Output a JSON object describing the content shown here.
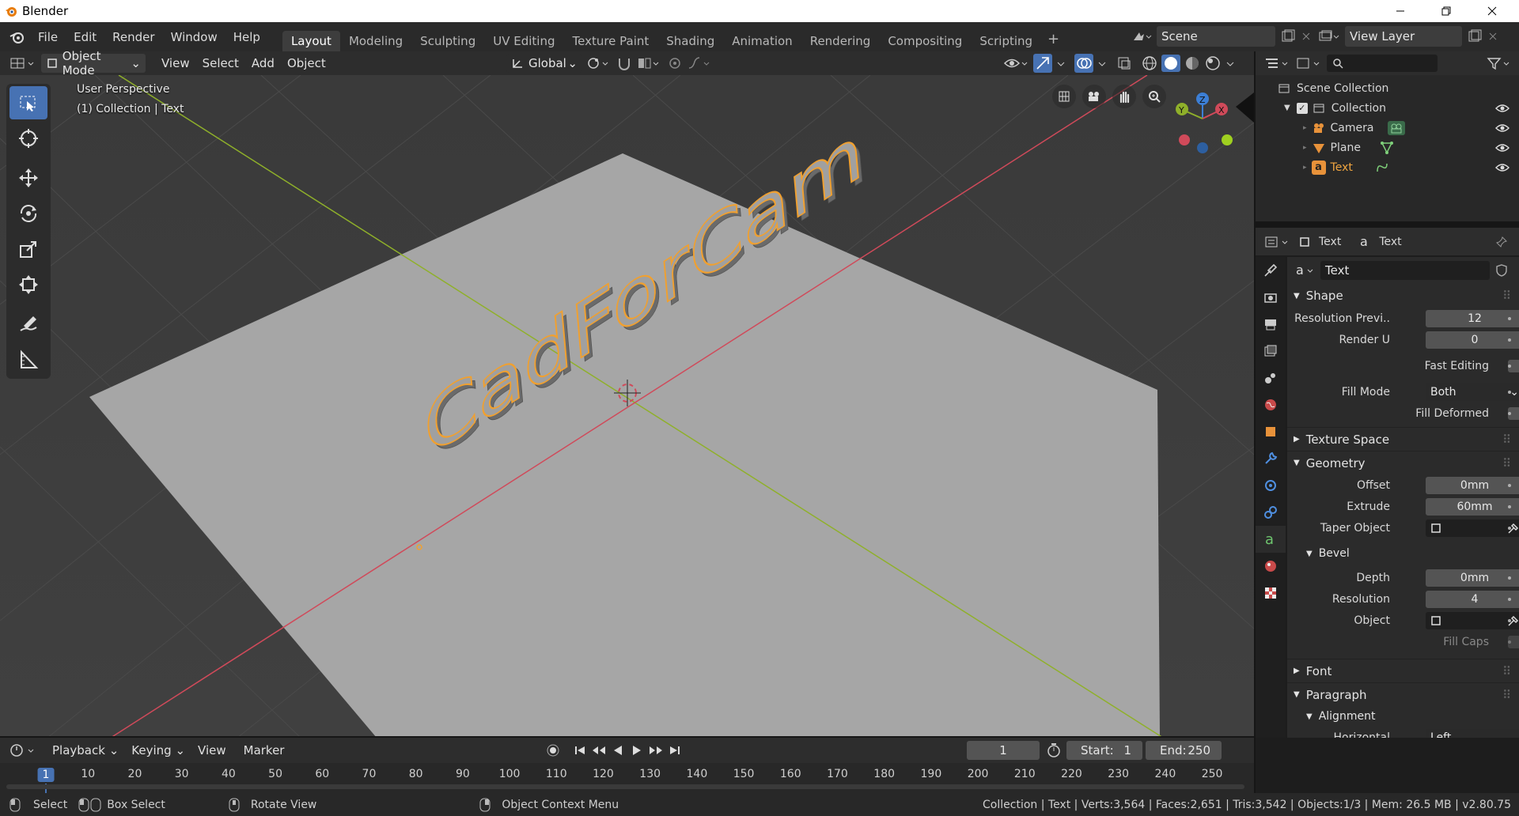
{
  "app": {
    "title": "Blender"
  },
  "menus": [
    "File",
    "Edit",
    "Render",
    "Window",
    "Help"
  ],
  "workspaces": [
    "Layout",
    "Modeling",
    "Sculpting",
    "UV Editing",
    "Texture Paint",
    "Shading",
    "Animation",
    "Rendering",
    "Compositing",
    "Scripting"
  ],
  "scene": {
    "name": "Scene",
    "view_layer": "View Layer"
  },
  "viewport_header": {
    "mode": "Object Mode",
    "menus": [
      "View",
      "Select",
      "Add",
      "Object"
    ],
    "orientation": "Global"
  },
  "viewport": {
    "perspective": "User Perspective",
    "context": "(1) Collection | Text",
    "model_text": "CadForCam",
    "gizmo": {
      "x": "X",
      "y": "Y",
      "z": "Z"
    }
  },
  "outliner": {
    "root": "Scene Collection",
    "collection": "Collection",
    "items": [
      {
        "name": "Camera",
        "icon": "camera-object-icon"
      },
      {
        "name": "Plane",
        "icon": "mesh-object-icon"
      },
      {
        "name": "Text",
        "icon": "text-object-icon",
        "selected": true
      }
    ]
  },
  "properties": {
    "breadcrumb_object": "Text",
    "breadcrumb_data": "Text",
    "datablock_name": "Text",
    "shape": {
      "title": "Shape",
      "resolution_preview_label": "Resolution Previ..",
      "resolution_preview": "12",
      "render_u_label": "Render U",
      "render_u": "0",
      "fast_editing_label": "Fast Editing",
      "fill_mode_label": "Fill Mode",
      "fill_mode": "Both",
      "fill_deformed_label": "Fill Deformed"
    },
    "texture_space_title": "Texture Space",
    "geometry": {
      "title": "Geometry",
      "offset_label": "Offset",
      "offset": "0mm",
      "extrude_label": "Extrude",
      "extrude": "60mm",
      "taper_label": "Taper Object"
    },
    "bevel": {
      "title": "Bevel",
      "depth_label": "Depth",
      "depth": "0mm",
      "resolution_label": "Resolution",
      "resolution": "4",
      "object_label": "Object",
      "fill_caps_label": "Fill Caps"
    },
    "font_title": "Font",
    "paragraph_title": "Paragraph",
    "alignment_title": "Alignment",
    "horizontal_label": "Horizontal",
    "horizontal_value": "Left"
  },
  "timeline": {
    "menus": [
      "Playback",
      "Keying",
      "View",
      "Marker"
    ],
    "current_frame": "1",
    "start_label": "Start:",
    "start": "1",
    "end_label": "End:",
    "end": "250",
    "ruler": [
      "1",
      "10",
      "20",
      "30",
      "40",
      "50",
      "60",
      "70",
      "80",
      "90",
      "100",
      "110",
      "120",
      "130",
      "140",
      "150",
      "160",
      "170",
      "180",
      "190",
      "200",
      "210",
      "220",
      "230",
      "240",
      "250"
    ]
  },
  "statusbar": {
    "select": "Select",
    "box_select": "Box Select",
    "rotate_view": "Rotate View",
    "context_menu": "Object Context Menu",
    "stats": "Collection | Text | Verts:3,564 | Faces:2,651 | Tris:3,542 | Objects:1/3 | Mem: 26.5 MB | v2.80.75"
  },
  "colors": {
    "accent": "#4772b3",
    "selection_outline": "#f0a030",
    "x_axis": "#d04a5a",
    "y_axis": "#8fb02a",
    "z_axis": "#3c7fd6"
  }
}
